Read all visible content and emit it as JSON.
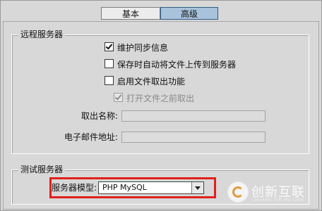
{
  "tabs": [
    {
      "label": "基本",
      "active": false
    },
    {
      "label": "高级",
      "active": true
    }
  ],
  "remote_server": {
    "title": "远程服务器",
    "options": [
      {
        "label": "维护同步信息",
        "checked": true,
        "enabled": true
      },
      {
        "label": "保存时自动将文件上传到服务器",
        "checked": false,
        "enabled": true
      },
      {
        "label": "启用文件取出功能",
        "checked": false,
        "enabled": true
      },
      {
        "label": "打开文件之前取出",
        "checked": true,
        "enabled": false
      }
    ],
    "checkout_name_label": "取出名称:",
    "email_label": "电子邮件地址:"
  },
  "testing_server": {
    "title": "测试服务器",
    "model_label": "服务器模型:",
    "model_value": "PHP MySQL"
  },
  "watermark": {
    "name": "创新互联",
    "sub": "CHUANG XIN HU LIAN"
  },
  "colors": {
    "highlight_box": "#e0201b",
    "active_tab": "#a9c3dc"
  }
}
